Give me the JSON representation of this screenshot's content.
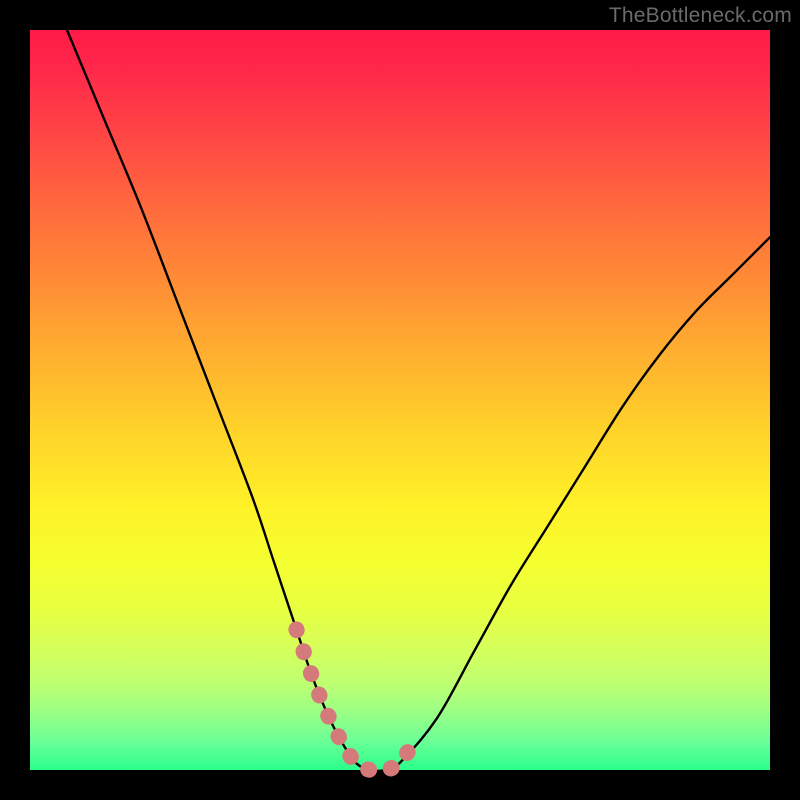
{
  "watermark": "TheBottleneck.com",
  "chart_data": {
    "type": "line",
    "title": "",
    "xlabel": "",
    "ylabel": "",
    "xlim": [
      0,
      100
    ],
    "ylim": [
      0,
      100
    ],
    "series": [
      {
        "name": "curve",
        "color": "#000000",
        "x": [
          5,
          10,
          15,
          20,
          25,
          30,
          33,
          36,
          38,
          40,
          42,
          44,
          46,
          48,
          50,
          55,
          60,
          65,
          70,
          75,
          80,
          85,
          90,
          95,
          100
        ],
        "values": [
          100,
          88,
          76,
          63,
          50,
          37,
          28,
          19,
          13,
          8,
          4,
          1,
          0,
          0,
          1,
          7,
          16,
          25,
          33,
          41,
          49,
          56,
          62,
          67,
          72
        ]
      },
      {
        "name": "bottom-highlight",
        "color": "#d47a7a",
        "x": [
          36,
          38,
          40,
          42,
          44,
          46,
          48,
          50,
          52
        ],
        "values": [
          19,
          13,
          8,
          4,
          1,
          0,
          0,
          1,
          4
        ]
      }
    ]
  },
  "colors": {
    "background": "#000000",
    "curve": "#000000",
    "highlight": "#d47a7a",
    "watermark": "#6a6a6a"
  }
}
